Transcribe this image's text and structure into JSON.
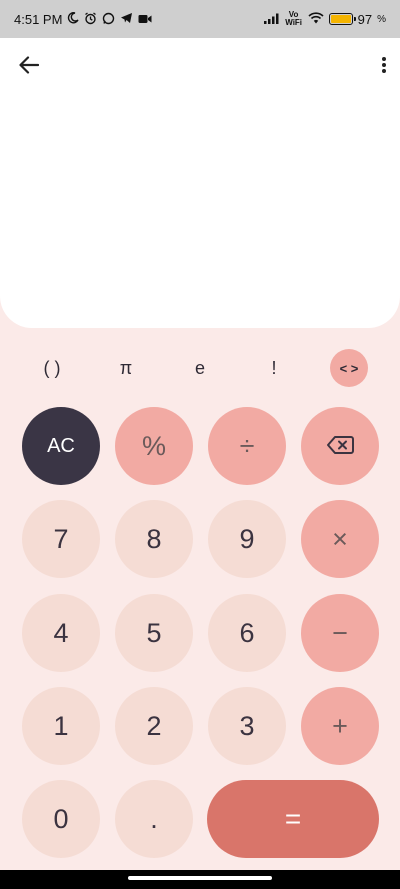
{
  "status_bar": {
    "time": "4:51 PM",
    "left_icons": [
      "moon-icon",
      "alarm-icon",
      "whatsapp-icon",
      "telegram-icon",
      "video-camera-icon"
    ],
    "right_icons": [
      "signal-icon",
      "vowifi-icon",
      "wifi-icon",
      "battery-icon"
    ],
    "vowifi_label": "Vo WiFi",
    "battery_percent": "97"
  },
  "header": {
    "back_icon": "arrow-left-icon",
    "menu_icon": "more-vertical-icon"
  },
  "scientific_row": {
    "parentheses": "( )",
    "pi": "π",
    "e": "e",
    "factorial": "!",
    "toggle": "< >"
  },
  "keypad": {
    "ac": "AC",
    "percent": "%",
    "divide": "÷",
    "backspace_icon": "backspace-icon",
    "seven": "7",
    "eight": "8",
    "nine": "9",
    "multiply": "×",
    "four": "4",
    "five": "5",
    "six": "6",
    "minus": "−",
    "one": "1",
    "two": "2",
    "three": "3",
    "plus": "+",
    "zero": "0",
    "dot": ".",
    "equals": "="
  },
  "colors": {
    "background": "#fbeae8",
    "display": "#ffffff",
    "number_key": "#f5dcd4",
    "operator_key": "#f2aaa3",
    "ac_key": "#3a3545",
    "equals_key": "#d9756a",
    "battery_fill": "#f4b400"
  }
}
